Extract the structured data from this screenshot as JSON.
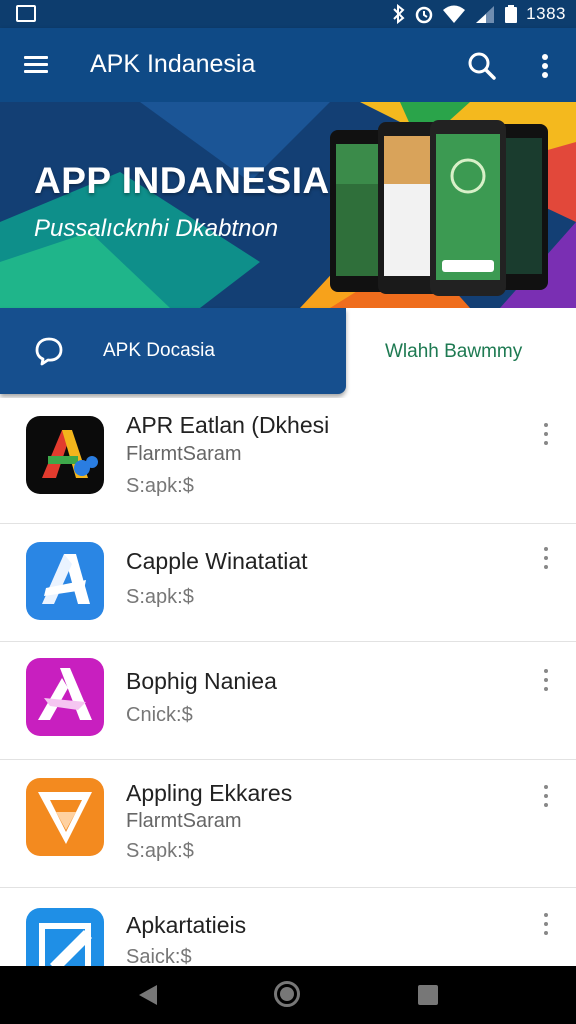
{
  "status_bar": {
    "time": "1383",
    "icons": [
      "image-icon",
      "bluetooth-icon",
      "alarm-icon",
      "wifi-icon",
      "signal-icon",
      "battery-icon"
    ]
  },
  "app_bar": {
    "title": "APK Indanesia",
    "icons": [
      "menu-icon",
      "search-icon",
      "more-vert-icon"
    ]
  },
  "banner": {
    "title": "APP INDANESIA",
    "subtitle": "Pussalıcknhi Dkabtnon"
  },
  "tabs": [
    {
      "label": "APK Docasia",
      "active": true,
      "icon": "chat-bubble-icon"
    },
    {
      "label": "Wlahh Bawmmy",
      "active": false
    }
  ],
  "apps": [
    {
      "name": "APR Eatlan (Dkhesi",
      "developer": "FlarmtSaram",
      "meta": "S:apk:$",
      "icon": "multicolor-a-icon"
    },
    {
      "name": "Capple Winatatiat",
      "developer": "",
      "meta": "S:apk:$",
      "icon": "blue-a-icon"
    },
    {
      "name": "Bophig Naniea",
      "developer": "",
      "meta": "Cnick:$",
      "icon": "magenta-x-icon"
    },
    {
      "name": "Appling Ekkares",
      "developer": "FlarmtSaram",
      "meta": "S:apk:$",
      "icon": "orange-v-icon"
    },
    {
      "name": "Apkartatieis",
      "developer": "",
      "meta": "Saick:$",
      "icon": "blue-edit-icon"
    }
  ],
  "colors": {
    "app_bar": "#0f4a86",
    "status_bar": "#0d3d6e",
    "active_tab": "#164f8e",
    "inactive_tab_text": "#1e7a52"
  },
  "nav_bar": {
    "icons": [
      "back-icon",
      "home-icon",
      "recents-icon"
    ]
  }
}
